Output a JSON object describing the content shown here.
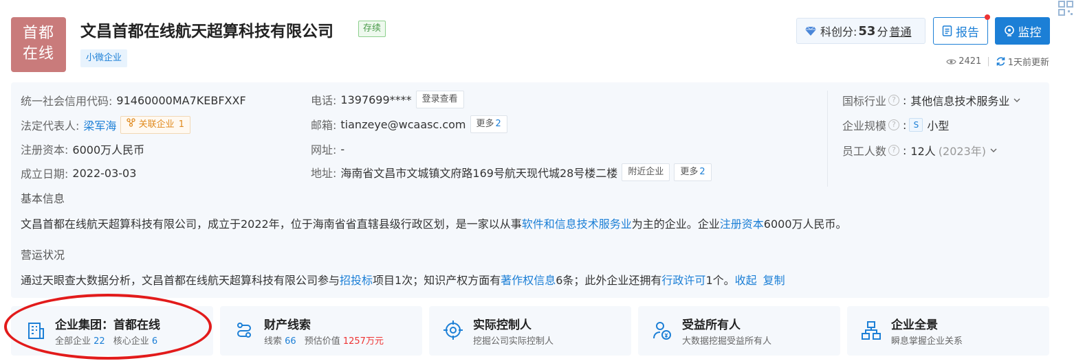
{
  "company": {
    "logo_line1": "首都",
    "logo_line2": "在线",
    "name": "文昌首都在线航天超算科技有限公司",
    "status": "存续",
    "size_tag": "小微企业"
  },
  "header": {
    "score_label": "科创分:",
    "score_value": "53",
    "score_unit": "分",
    "score_level": "普通",
    "report_label": "报告",
    "monitor_label": "监控",
    "views": "2421",
    "updated": "1天前更新"
  },
  "info": {
    "credit_code_label": "统一社会信用代码:",
    "credit_code": "91460000MA7KEBFXXF",
    "legal_rep_label": "法定代表人:",
    "legal_rep": "梁军海",
    "related_label": "关联企业",
    "related_count": "1",
    "capital_label": "注册资本:",
    "capital": "6000万人民币",
    "founded_label": "成立日期:",
    "founded": "2022-03-03",
    "phone_label": "电话:",
    "phone": "1397699****",
    "phone_btn": "登录查看",
    "email_label": "邮箱:",
    "email": "tianzeye@wcaasc.com",
    "more_label": "更多",
    "email_more": "2",
    "website_label": "网址:",
    "website": "-",
    "address_label": "地址:",
    "address": "海南省文昌市文城镇文府路169号航天现代城28号楼二楼",
    "nearby_label": "附近企业",
    "address_more": "2",
    "industry_label": "国标行业",
    "industry": "其他信息技术服务业",
    "scale_label": "企业规模",
    "scale_badge": "S",
    "scale": "小型",
    "staff_label": "员工人数",
    "staff": "12人",
    "staff_year": "(2023年)"
  },
  "basic": {
    "heading": "基本信息",
    "p1": "文昌首都在线航天超算科技有限公司，成立于2022年，位于海南省省直辖县级行政区划，是一家以从事",
    "link1": "软件和信息技术服务业",
    "p2": "为主的企业。企业",
    "link2": "注册资本",
    "p3": "6000万人民币。"
  },
  "ops": {
    "heading": "营运状况",
    "p1": "通过天眼查大数据分析，文昌首都在线航天超算科技有限公司参与",
    "link1": "招投标",
    "p2": "项目1次；知识产权方面有",
    "link2": "著作权信息",
    "p3": "6条；此外企业还拥有",
    "link3": "行政许可",
    "p4": "1个。",
    "collapse": "收起",
    "copy": "复制"
  },
  "cards": [
    {
      "title": "企业集团：首都在线",
      "sub_a": "全部企业",
      "num_a": "22",
      "sub_b": "核心企业",
      "num_b": "6"
    },
    {
      "title": "财产线索",
      "sub_a": "线索",
      "num_a": "66",
      "sub_b": "预估价值",
      "num_b": "1257万元"
    },
    {
      "title": "实际控制人",
      "sub": "挖掘公司实际控制人"
    },
    {
      "title": "受益所有人",
      "sub": "大数据挖掘受益所有人"
    },
    {
      "title": "企业全景",
      "sub": "瞬息掌握企业关系"
    }
  ],
  "colors": {
    "accent": "#1c7fd6",
    "logo_bg": "#c97b7b",
    "highlight": "#e21b1b"
  }
}
